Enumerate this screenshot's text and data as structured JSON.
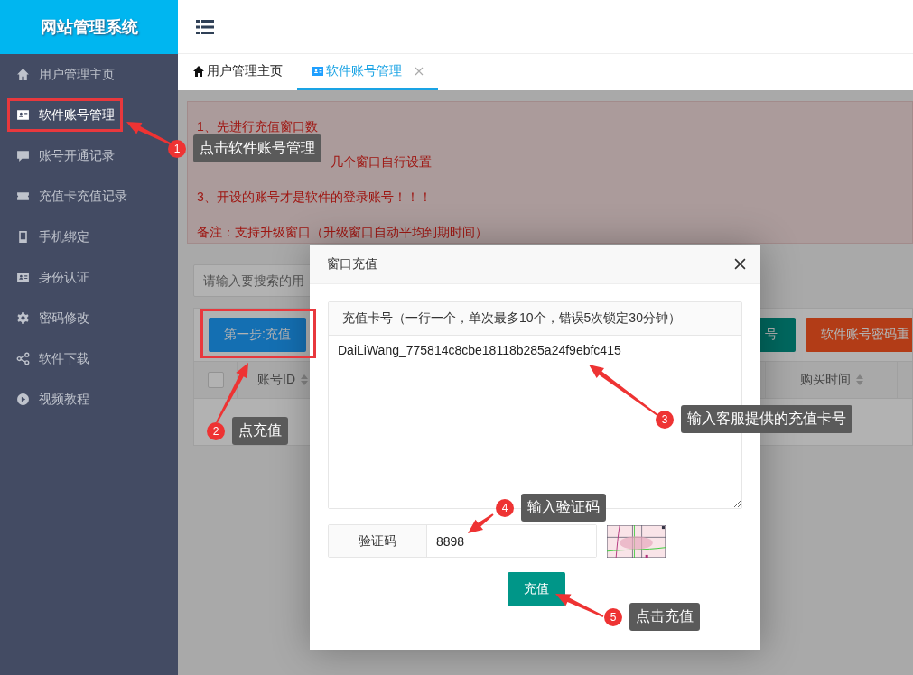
{
  "sidebar": {
    "title": "网站管理系统",
    "items": [
      {
        "label": "用户管理主页",
        "selected": false
      },
      {
        "label": "软件账号管理",
        "selected": true
      },
      {
        "label": "账号开通记录",
        "selected": false
      },
      {
        "label": "充值卡充值记录",
        "selected": false
      },
      {
        "label": "手机绑定",
        "selected": false
      },
      {
        "label": "身份认证",
        "selected": false
      },
      {
        "label": "密码修改",
        "selected": false
      },
      {
        "label": "软件下载",
        "selected": false
      },
      {
        "label": "视频教程",
        "selected": false
      }
    ]
  },
  "tabs": [
    {
      "label": "用户管理主页",
      "selected": false,
      "closable": false
    },
    {
      "label": "软件账号管理",
      "selected": true,
      "closable": true
    }
  ],
  "notice": {
    "lines": [
      "1、先进行充值窗口数",
      "几个窗口自行设置",
      "3、开设的账号才是软件的登录账号！！！",
      "备注：支持升级窗口（升级窗口自动平均到期时间）"
    ]
  },
  "search": {
    "placeholder": "请输入要搜索的用"
  },
  "toolbar_buttons": [
    {
      "label": "第一步:充值",
      "kind": "primary"
    },
    {
      "label": "号",
      "kind": "success"
    },
    {
      "label": "软件账号密码重",
      "kind": "danger"
    }
  ],
  "table": {
    "select_all": {
      "checked": false
    },
    "columns": [
      {
        "label": "账号ID"
      },
      {
        "label": "购买时间"
      }
    ]
  },
  "modal": {
    "title": "窗口充值",
    "card_field": {
      "label": "充值卡号（一行一个，单次最多10个，错误5次锁定30分钟）",
      "value": "DaiLiWang_775814c8cbe18118b285a24f9ebfc415"
    },
    "captcha": {
      "label": "验证码",
      "value": "8898"
    },
    "submit": "充值"
  },
  "callouts": [
    {
      "number": "1",
      "text": "点击软件账号管理"
    },
    {
      "number": "2",
      "text": "点充值"
    },
    {
      "number": "3",
      "text": "输入客服提供的充值卡号"
    },
    {
      "number": "4",
      "text": "输入验证码"
    },
    {
      "number": "5",
      "text": "点击充值"
    }
  ]
}
